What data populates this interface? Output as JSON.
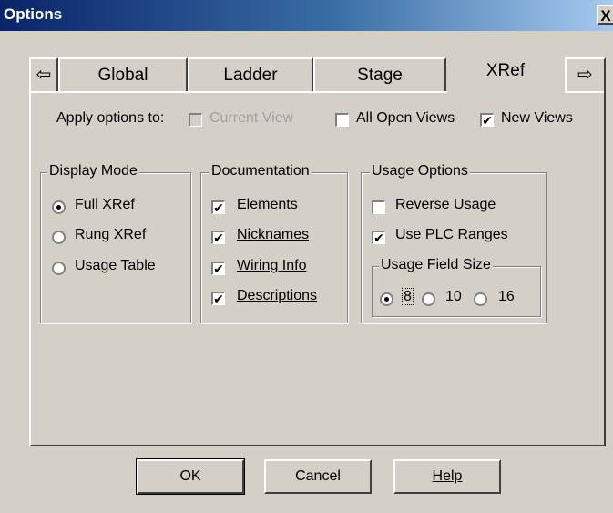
{
  "window": {
    "title": "Options",
    "close_label": "X"
  },
  "tabs": [
    {
      "label": "Global"
    },
    {
      "label": "Ladder"
    },
    {
      "label": "Stage"
    },
    {
      "label": "XRef",
      "active": true
    }
  ],
  "tab_nav": {
    "prev_icon": "left-arrow-icon",
    "next_icon": "right-arrow-icon",
    "prev_glyph": "⇦",
    "next_glyph": "⇨"
  },
  "apply": {
    "label": "Apply options to:",
    "current_view": {
      "label": "Current View",
      "checked": false,
      "enabled": false
    },
    "all_open_views": {
      "label": "All Open Views",
      "checked": false
    },
    "new_views": {
      "label": "New Views",
      "checked": true
    }
  },
  "display_mode": {
    "title": "Display Mode",
    "options": [
      {
        "label": "Full XRef",
        "selected": true
      },
      {
        "label": "Rung XRef",
        "selected": false
      },
      {
        "label": "Usage Table",
        "selected": false
      }
    ]
  },
  "documentation": {
    "title": "Documentation",
    "items": [
      {
        "label": "Elements",
        "checked": true
      },
      {
        "label": "Nicknames",
        "checked": true
      },
      {
        "label": "Wiring Info",
        "checked": true
      },
      {
        "label": "Descriptions",
        "checked": true
      }
    ]
  },
  "usage_options": {
    "title": "Usage Options",
    "reverse_usage": {
      "label": "Reverse Usage",
      "checked": false
    },
    "use_plc_ranges": {
      "label": "Use PLC Ranges",
      "checked": true
    },
    "field_size": {
      "title": "Usage Field Size",
      "options": [
        {
          "label": "8",
          "selected": true
        },
        {
          "label": "10",
          "selected": false
        },
        {
          "label": "16",
          "selected": false
        }
      ]
    }
  },
  "buttons": {
    "ok": "OK",
    "cancel": "Cancel",
    "help": "Help"
  },
  "check_glyph": "✔"
}
